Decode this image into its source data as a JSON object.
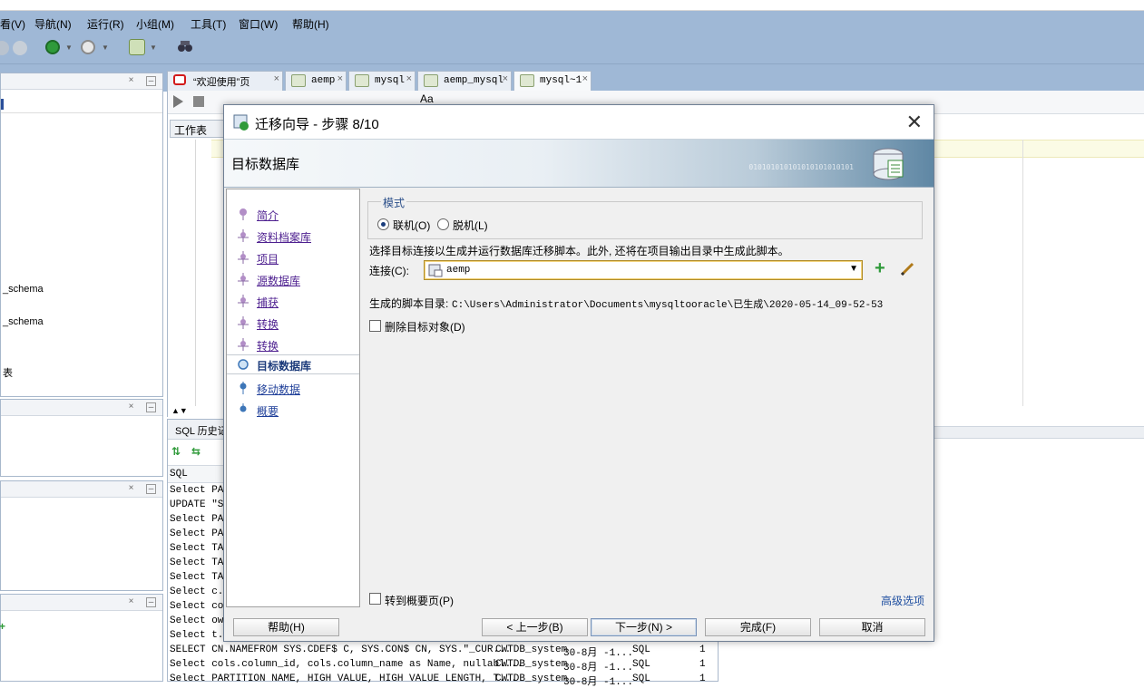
{
  "menu": [
    "看(V)",
    "导航(N)",
    "运行(R)",
    "小组(M)",
    "工具(T)",
    "窗口(W)",
    "帮助(H)"
  ],
  "left_panel": {
    "items": [
      "_schema",
      "_schema",
      "表"
    ]
  },
  "editor": {
    "tabs": [
      {
        "label": "“欢迎使用”页"
      },
      {
        "label": "aemp"
      },
      {
        "label": "mysql"
      },
      {
        "label": "aemp_mysql"
      },
      {
        "label": "mysql~1"
      }
    ],
    "toolbar_font_label": "Aa",
    "worksheet_label": "工作表"
  },
  "sql_history": {
    "header": "SQL 历史记",
    "column_label": "SQL",
    "rows": [
      "Select PAR",
      "UPDATE \"SY",
      "Select PAR",
      "Select PAR",
      "Select  TA",
      "Select  TA",
      "Select  TA",
      "Select c.c",
      "Select col",
      "Select own",
      "Select t.t",
      "SELECT CN.NAMEFROM   SYS.CDEF$ C, SYS.CON$ CN, SYS.\"_CUR...",
      "Select cols.column_id, cols.column_name as Name, nullabl...",
      "Select PARTITION NAME,  HIGH VALUE, HIGH VALUE LENGTH, T..."
    ],
    "full_rows": [
      {
        "conn": "CWTDB_system",
        "date": "30-8月 -1...",
        "type": "SQL",
        "count": "1"
      },
      {
        "conn": "CWTDB_system",
        "date": "30-8月 -1...",
        "type": "SQL",
        "count": "1"
      },
      {
        "conn": "CWTDB_system",
        "date": "30-8月 -1...",
        "type": "SQL",
        "count": "1"
      }
    ]
  },
  "dialog": {
    "title": "迁移向导 - 步骤 8/10",
    "header": "目标数据库",
    "header_binary": "010101010101010101010101",
    "steps": [
      {
        "label": "简介",
        "state": "done"
      },
      {
        "label": "资料档案库",
        "state": "done"
      },
      {
        "label": "项目",
        "state": "done"
      },
      {
        "label": "源数据库",
        "state": "done"
      },
      {
        "label": "捕获 ",
        "state": "done"
      },
      {
        "label": "转换",
        "state": "done"
      },
      {
        "label": "转换",
        "state": "done"
      },
      {
        "label": "目标数据库",
        "state": "current"
      },
      {
        "label": "移动数据",
        "state": "todo"
      },
      {
        "label": "概要",
        "state": "todo"
      }
    ],
    "mode": {
      "label": "模式",
      "online": "联机(O)",
      "offline": "脱机(L)",
      "selected": "online"
    },
    "instruction": "选择目标连接以生成并运行数据库迁移脚本。此外, 还将在项目输出目录中生成此脚本。",
    "connection_label": "连接(C):",
    "connection_value": "aemp",
    "script_dir_label": "生成的脚本目录:",
    "script_dir_value": "C:\\Users\\Administrator\\Documents\\mysqltooracle\\已生成\\2020-05-14_09-52-53",
    "drop_target_label": "删除目标对象(D)",
    "drop_target_checked": false,
    "goto_summary_label": "转到概要页(P)",
    "goto_summary_checked": false,
    "advanced_link": "高级选项",
    "buttons": {
      "help": "帮助(H)",
      "back": "< 上一步(B)",
      "next": "下一步(N) >",
      "finish": "完成(F)",
      "cancel": "取消"
    }
  },
  "colors": {
    "chrome": "#9fb8d6",
    "link": "#4d1f8f",
    "current_step": "#1b3a7a",
    "accent_link": "#1f4fa0"
  }
}
